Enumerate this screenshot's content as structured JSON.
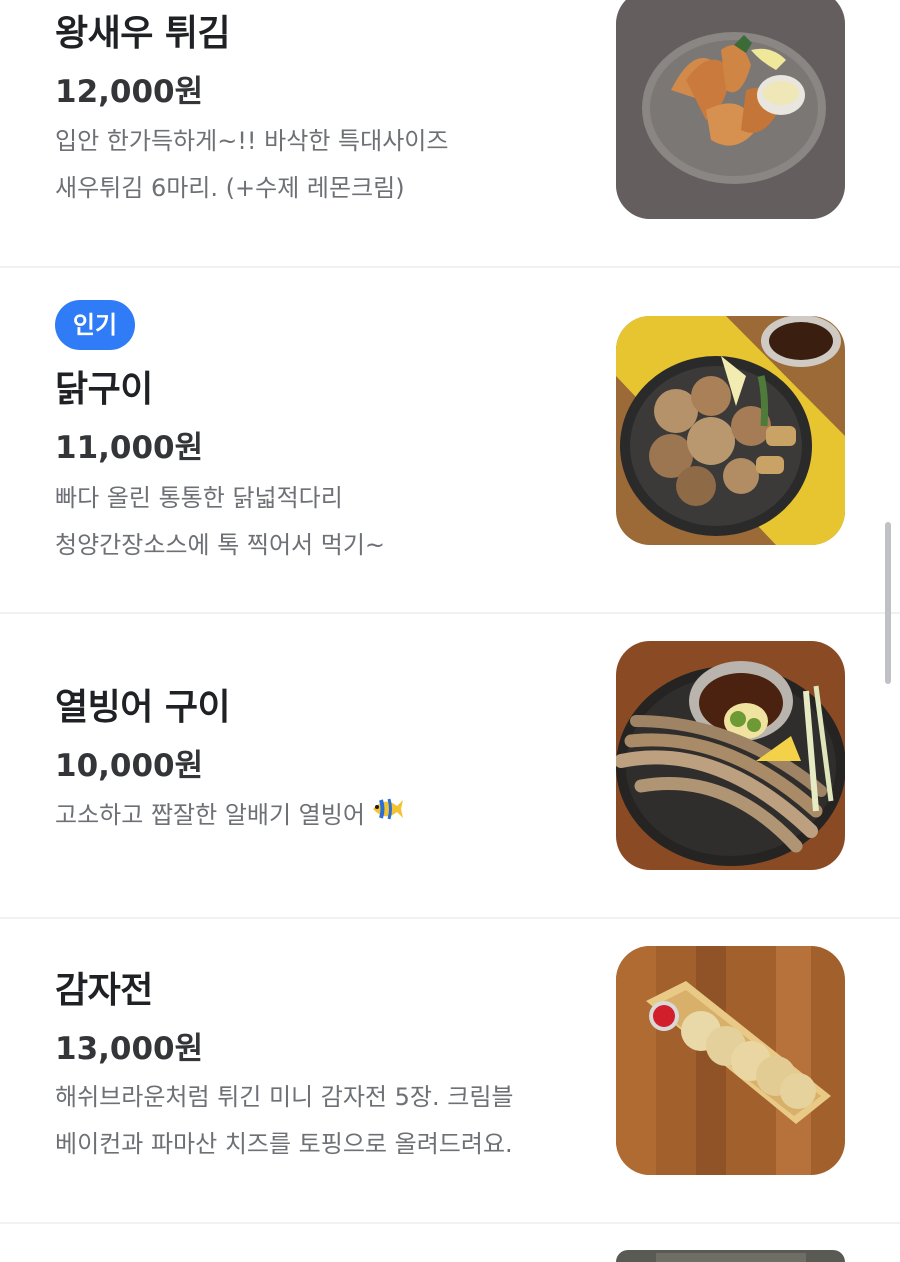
{
  "menu": {
    "items": [
      {
        "name": "왕새우 튀김",
        "price": "12,000원",
        "desc_line1": "입안 한가득하게~!! 바삭한 특대사이즈",
        "desc_line2": "새우튀김 6마리. (+수제 레몬크림)",
        "photo_icon": "fried-shrimp-photo"
      },
      {
        "badge": "인기",
        "name": "닭구이",
        "price": "11,000원",
        "desc_line1": "빠다 올린 통통한 닭넓적다리",
        "desc_line2": "청양간장소스에 톡 찍어서 먹기~",
        "photo_icon": "grilled-chicken-photo"
      },
      {
        "name": "열빙어 구이",
        "price": "10,000원",
        "desc_line1": "고소하고 짭잘한 알배기 열빙어",
        "emoji_icon": "tropical-fish-emoji",
        "photo_icon": "grilled-smelt-photo"
      },
      {
        "name": "감자전",
        "price": "13,000원",
        "desc_line1": "해쉬브라운처럼 튀긴 미니 감자전 5장. 크림블",
        "desc_line2": "베이컨과 파마산 치즈를 토핑으로 올려드려요.",
        "photo_icon": "potato-pancake-photo"
      }
    ]
  },
  "colors": {
    "badge_blue": "#2f7cf6",
    "title": "#1f2124",
    "description_gray": "#6d7075",
    "divider": "#f0f1f3"
  }
}
